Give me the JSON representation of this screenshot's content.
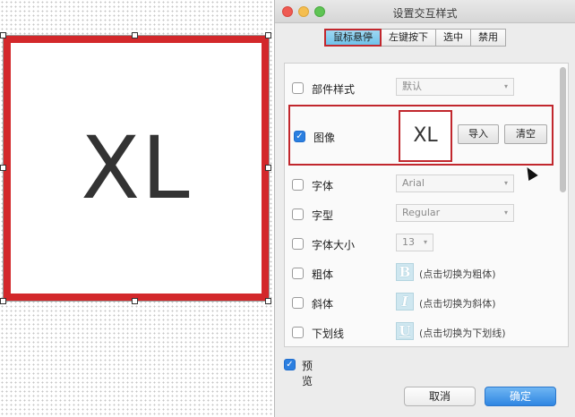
{
  "canvas": {
    "widget_text": "XL"
  },
  "dialog": {
    "title": "设置交互样式",
    "tabs": [
      {
        "label": "鼠标悬停",
        "active": true
      },
      {
        "label": "左键按下",
        "active": false
      },
      {
        "label": "选中",
        "active": false
      },
      {
        "label": "禁用",
        "active": false
      }
    ],
    "rows": {
      "part_style": {
        "label": "部件样式",
        "value": "默认",
        "checked": false
      },
      "image": {
        "label": "图像",
        "checked": true,
        "preview_text": "XL",
        "import_label": "导入",
        "clear_label": "清空"
      },
      "font": {
        "label": "字体",
        "value": "Arial",
        "checked": false
      },
      "font_type": {
        "label": "字型",
        "value": "Regular",
        "checked": false
      },
      "font_size": {
        "label": "字体大小",
        "value": "13",
        "checked": false
      },
      "bold": {
        "label": "粗体",
        "icon_letter": "B",
        "hint": "(点击切换为粗体)",
        "checked": false
      },
      "italic": {
        "label": "斜体",
        "icon_letter": "I",
        "hint": "(点击切换为斜体)",
        "checked": false
      },
      "underline": {
        "label": "下划线",
        "icon_letter": "U",
        "hint": "(点击切换为下划线)",
        "checked": false
      }
    },
    "preview": {
      "label": "预览",
      "checked": true
    },
    "cancel_label": "取消",
    "ok_label": "确定",
    "check_mark": "✓",
    "arrow": "▾",
    "colors": {
      "accent_red": "#c1272d",
      "tab_blue": "#6ec2ea",
      "ok_blue": "#2f86e2"
    }
  }
}
